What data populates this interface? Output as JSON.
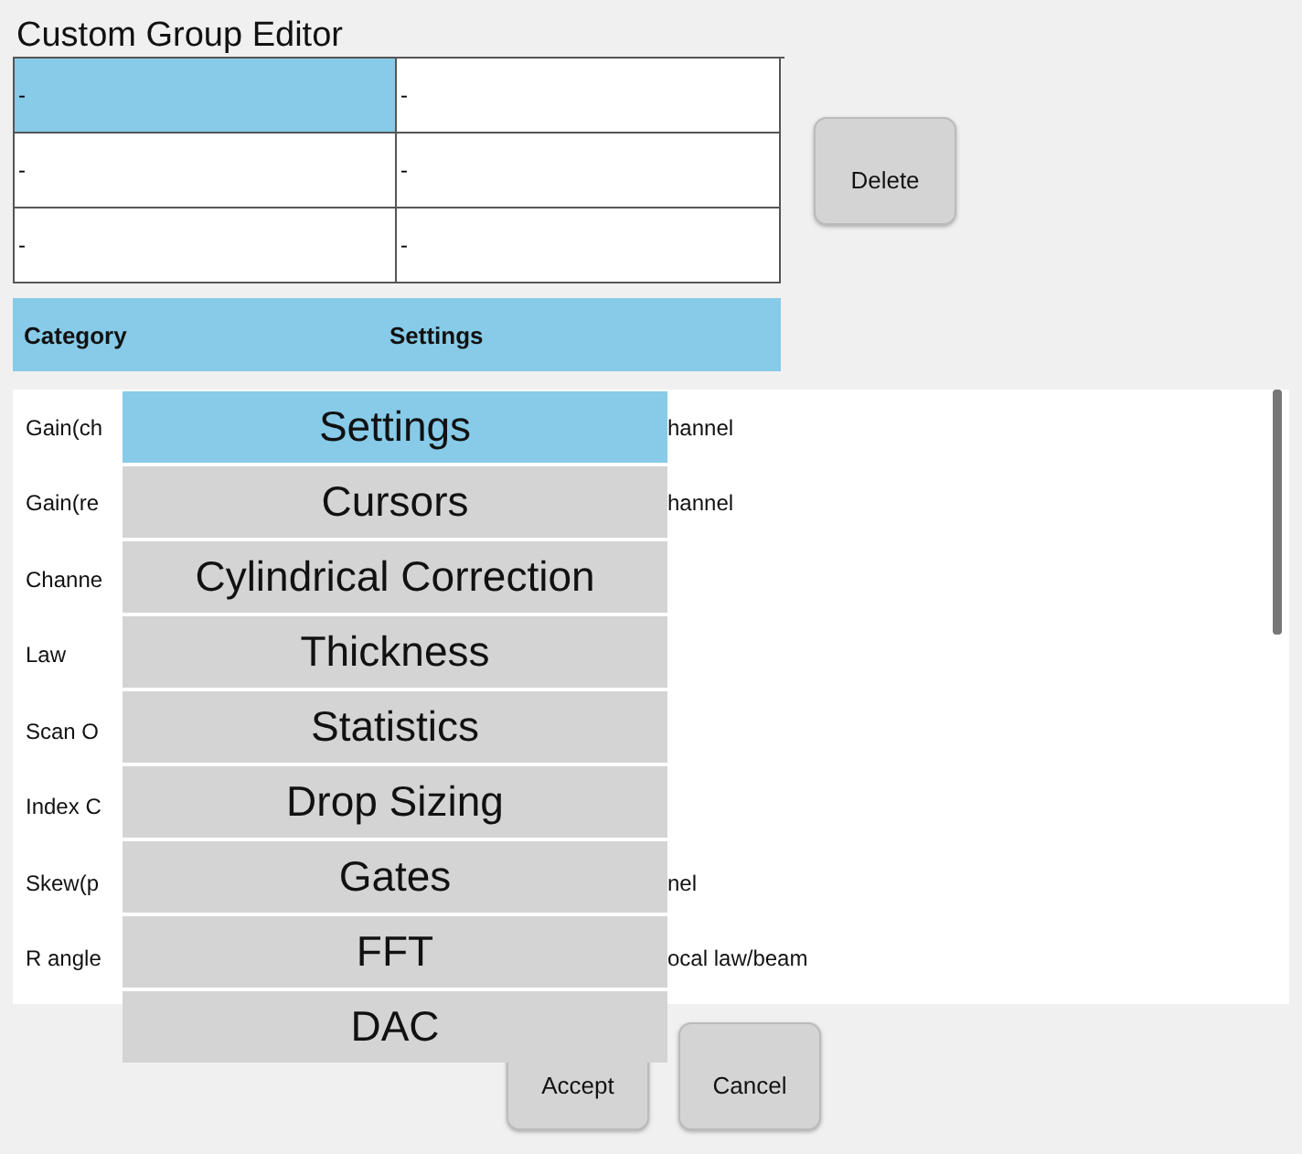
{
  "window": {
    "title": "Custom Group Editor"
  },
  "grid": [
    [
      {
        "text": "-",
        "selected": true
      },
      {
        "text": "-",
        "selected": false
      }
    ],
    [
      {
        "text": "-",
        "selected": false
      },
      {
        "text": "-",
        "selected": false
      }
    ],
    [
      {
        "text": "-",
        "selected": false
      },
      {
        "text": "-",
        "selected": false
      }
    ]
  ],
  "delete_button": "Delete",
  "header": {
    "category": "Category",
    "settings": "Settings"
  },
  "rows": [
    {
      "category": "Gain(ch",
      "settings": "hannel"
    },
    {
      "category": "Gain(re",
      "settings": "hannel"
    },
    {
      "category": "Channe",
      "settings": ""
    },
    {
      "category": "Law",
      "settings": ""
    },
    {
      "category": "Scan O",
      "settings": ""
    },
    {
      "category": "Index C",
      "settings": ""
    },
    {
      "category": "Skew(p",
      "settings": "nel"
    },
    {
      "category": "R angle",
      "settings": "ocal law/beam"
    }
  ],
  "dropdown": [
    {
      "label": "Settings",
      "selected": true
    },
    {
      "label": "Cursors",
      "selected": false
    },
    {
      "label": "Cylindrical Correction",
      "selected": false
    },
    {
      "label": "Thickness",
      "selected": false
    },
    {
      "label": "Statistics",
      "selected": false
    },
    {
      "label": "Drop Sizing",
      "selected": false
    },
    {
      "label": "Gates",
      "selected": false
    },
    {
      "label": "FFT",
      "selected": false
    },
    {
      "label": "DAC",
      "selected": false
    }
  ],
  "buttons": [
    "Accept",
    "Cancel"
  ]
}
